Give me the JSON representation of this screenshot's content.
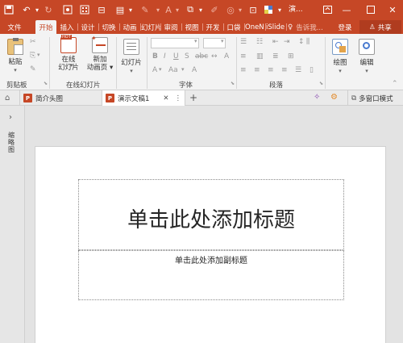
{
  "title_bar": {
    "doc_short": "演...",
    "colors": {
      "accent": "#c64726",
      "ribbon": "#f3f3f3",
      "canvas": "#e3e3e3"
    }
  },
  "tabs": [
    "文件",
    "开始",
    "插入",
    "设计",
    "切换",
    "动画",
    "幻灯片",
    "审阅",
    "视图",
    "开发",
    "口袋",
    "OneN",
    "iSlide"
  ],
  "tab_active": "开始",
  "tell_me": "告诉我...",
  "login": "登录",
  "share": "共享",
  "ribbon": {
    "paste": "粘贴",
    "new_slide_line1": "在线",
    "new_slide_line2": "幻灯片",
    "add_anim_line1": "新加",
    "add_anim_line2": "动画页",
    "slides_btn": "幻灯片",
    "draw": "绘图",
    "edit": "编辑",
    "group_clipboard": "剪贴板",
    "group_online": "在线幻灯片",
    "group_font": "字体",
    "group_paragraph": "段落",
    "font_aa": "Aa"
  },
  "doc_tabs": [
    {
      "label": "简介头图"
    },
    {
      "label": "演示文稿1"
    }
  ],
  "multi_window": "多窗口模式",
  "side_label": "缩略图",
  "slide": {
    "title_placeholder": "单击此处添加标题",
    "subtitle_placeholder": "单击此处添加副标题"
  }
}
